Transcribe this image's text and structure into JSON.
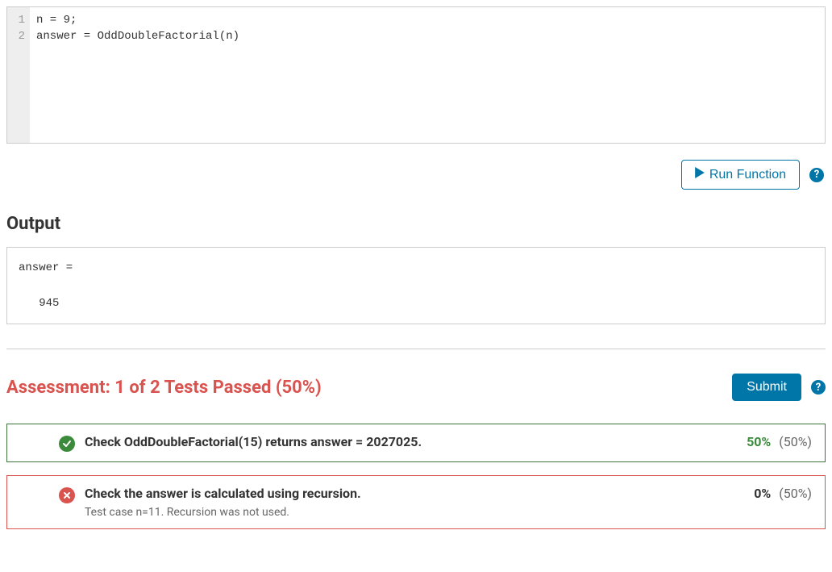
{
  "editor": {
    "lines": [
      "n = 9;",
      "answer = OddDoubleFactorial(n)"
    ]
  },
  "run_button": "Run Function",
  "output": {
    "title": "Output",
    "text": "answer =\n\n   945"
  },
  "assessment": {
    "title": "Assessment: 1 of 2 Tests Passed (50%)",
    "submit": "Submit"
  },
  "tests": [
    {
      "status": "pass",
      "title": "Check OddDoubleFactorial(15) returns answer = 2027025.",
      "detail": "",
      "earned": "50%",
      "total": "(50%)"
    },
    {
      "status": "fail",
      "title": "Check the answer is calculated using recursion.",
      "detail": "Test case n=11.  Recursion was not used.",
      "earned": "0%",
      "total": "(50%)"
    }
  ]
}
